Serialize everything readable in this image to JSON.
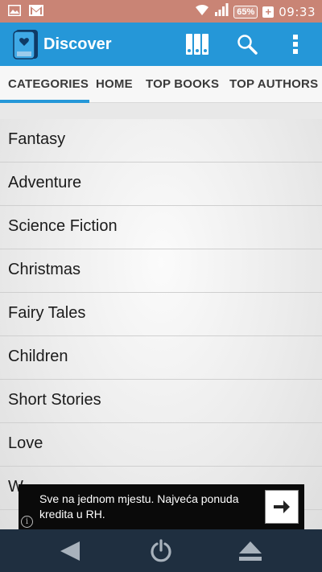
{
  "status_bar": {
    "icons": [
      "image-icon",
      "gmail-icon",
      "wifi-icon",
      "signal-icon"
    ],
    "battery": "65%",
    "charging": "+",
    "time": "09:33"
  },
  "app_bar": {
    "title": "Discover",
    "actions": [
      "library-icon",
      "search-icon",
      "overflow-menu-icon"
    ]
  },
  "tabs": [
    {
      "label": "CATEGORIES",
      "selected": true
    },
    {
      "label": "HOME",
      "selected": false
    },
    {
      "label": "TOP BOOKS",
      "selected": false
    },
    {
      "label": "TOP AUTHORS",
      "selected": false
    }
  ],
  "categories": [
    "Fantasy",
    "Adventure",
    "Science Fiction",
    "Christmas",
    "Fairy Tales",
    "Children",
    "Short Stories",
    "Love",
    "W"
  ],
  "ad": {
    "text": "Sve na jednom mjestu. Najveća ponuda kredita u RH.",
    "info_glyph": "i",
    "cta_icon": "arrow-right-icon"
  },
  "nav_bar": {
    "buttons": [
      "back-icon",
      "power-icon",
      "eject-icon"
    ]
  },
  "colors": {
    "status_bar": "#c98475",
    "app_bar": "#2597d8",
    "tab_indicator": "#2597d8",
    "nav_bar": "#1f2f40",
    "ad_background": "#0a0a0a"
  }
}
